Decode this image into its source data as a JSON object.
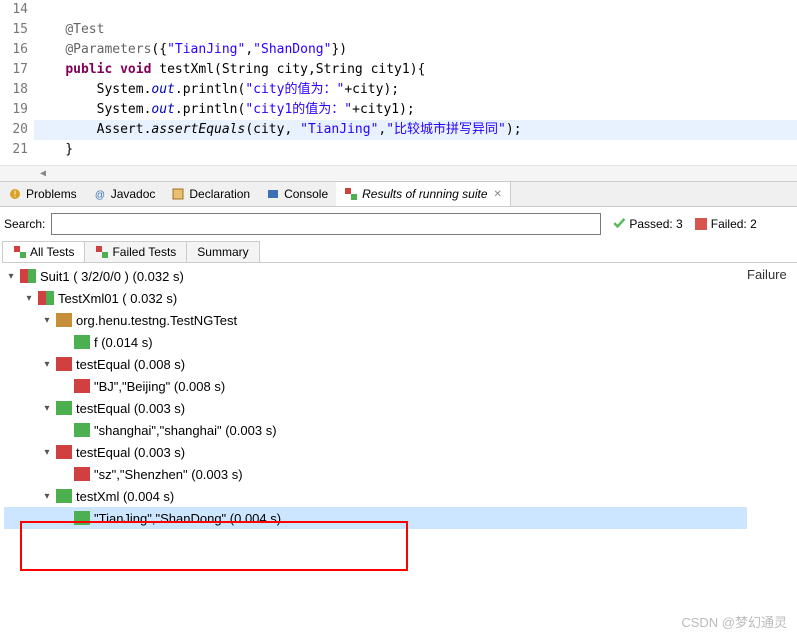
{
  "editor": {
    "lines": [
      {
        "num": 14,
        "segments": []
      },
      {
        "num": 15,
        "segments": [
          {
            "txt": "    ",
            "cls": ""
          },
          {
            "txt": "@Test",
            "cls": "ann"
          }
        ]
      },
      {
        "num": 16,
        "segments": [
          {
            "txt": "    ",
            "cls": ""
          },
          {
            "txt": "@Parameters",
            "cls": "ann"
          },
          {
            "txt": "({",
            "cls": ""
          },
          {
            "txt": "\"TianJing\"",
            "cls": "str"
          },
          {
            "txt": ",",
            "cls": ""
          },
          {
            "txt": "\"ShanDong\"",
            "cls": "str"
          },
          {
            "txt": "})",
            "cls": ""
          }
        ]
      },
      {
        "num": 17,
        "segments": [
          {
            "txt": "    ",
            "cls": ""
          },
          {
            "txt": "public",
            "cls": "kw"
          },
          {
            "txt": " ",
            "cls": ""
          },
          {
            "txt": "void",
            "cls": "kw"
          },
          {
            "txt": " testXml(String city,String city1){",
            "cls": ""
          }
        ]
      },
      {
        "num": 18,
        "segments": [
          {
            "txt": "        System.",
            "cls": ""
          },
          {
            "txt": "out",
            "cls": "static"
          },
          {
            "txt": ".println(",
            "cls": ""
          },
          {
            "txt": "\"city的值为：\"",
            "cls": "str"
          },
          {
            "txt": "+city);",
            "cls": ""
          }
        ]
      },
      {
        "num": 19,
        "segments": [
          {
            "txt": "        System.",
            "cls": ""
          },
          {
            "txt": "out",
            "cls": "static"
          },
          {
            "txt": ".println(",
            "cls": ""
          },
          {
            "txt": "\"city1的值为：\"",
            "cls": "str"
          },
          {
            "txt": "+city1);",
            "cls": ""
          }
        ]
      },
      {
        "num": 20,
        "hl": true,
        "segments": [
          {
            "txt": "        Assert.",
            "cls": ""
          },
          {
            "txt": "assertEquals",
            "cls": "method-italic"
          },
          {
            "txt": "(city, ",
            "cls": ""
          },
          {
            "txt": "\"TianJing\"",
            "cls": "str"
          },
          {
            "txt": ",",
            "cls": ""
          },
          {
            "txt": "\"比较城市拼写异同\"",
            "cls": "str"
          },
          {
            "txt": ");",
            "cls": ""
          }
        ]
      },
      {
        "num": 21,
        "segments": [
          {
            "txt": "    }",
            "cls": ""
          }
        ]
      }
    ]
  },
  "tabs": [
    {
      "label": "Problems"
    },
    {
      "label": "Javadoc"
    },
    {
      "label": "Declaration"
    },
    {
      "label": "Console"
    },
    {
      "label": "Results of running suite",
      "active": true
    }
  ],
  "search": {
    "label": "Search:",
    "placeholder": "",
    "passed_label": "Passed: 3",
    "failed_label": "Failed: 2"
  },
  "subtabs": [
    {
      "label": "All Tests",
      "active": true
    },
    {
      "label": "Failed Tests"
    },
    {
      "label": "Summary"
    }
  ],
  "tree": [
    {
      "indent": 0,
      "twisty": "▾",
      "icon": "ico-mix",
      "label": "Suit1 ( 3/2/0/0 ) (0.032 s)"
    },
    {
      "indent": 1,
      "twisty": "▾",
      "icon": "ico-mix",
      "label": "TestXml01 ( 0.032 s)"
    },
    {
      "indent": 2,
      "twisty": "▾",
      "icon": "ico-pkg",
      "label": "org.henu.testng.TestNGTest"
    },
    {
      "indent": 3,
      "twisty": "",
      "icon": "ico-green",
      "label": "f  (0.014 s)"
    },
    {
      "indent": 2,
      "twisty": "▾",
      "icon": "ico-red",
      "label": "testEqual  (0.008 s)"
    },
    {
      "indent": 3,
      "twisty": "",
      "icon": "ico-red",
      "label": "\"BJ\",\"Beijing\"  (0.008 s)"
    },
    {
      "indent": 2,
      "twisty": "▾",
      "icon": "ico-green",
      "label": "testEqual  (0.003 s)"
    },
    {
      "indent": 3,
      "twisty": "",
      "icon": "ico-green",
      "label": "\"shanghai\",\"shanghai\"  (0.003 s)"
    },
    {
      "indent": 2,
      "twisty": "▾",
      "icon": "ico-red",
      "label": "testEqual  (0.003 s)"
    },
    {
      "indent": 3,
      "twisty": "",
      "icon": "ico-red",
      "label": "\"sz\",\"Shenzhen\"  (0.003 s)"
    },
    {
      "indent": 2,
      "twisty": "▾",
      "icon": "ico-green",
      "label": "testXml  (0.004 s)"
    },
    {
      "indent": 3,
      "twisty": "",
      "icon": "ico-green",
      "label": "\"TianJing\",\"ShanDong\"  (0.004 s)",
      "sel": true
    }
  ],
  "failure_title": "Failure",
  "watermark": "CSDN @梦幻通灵"
}
